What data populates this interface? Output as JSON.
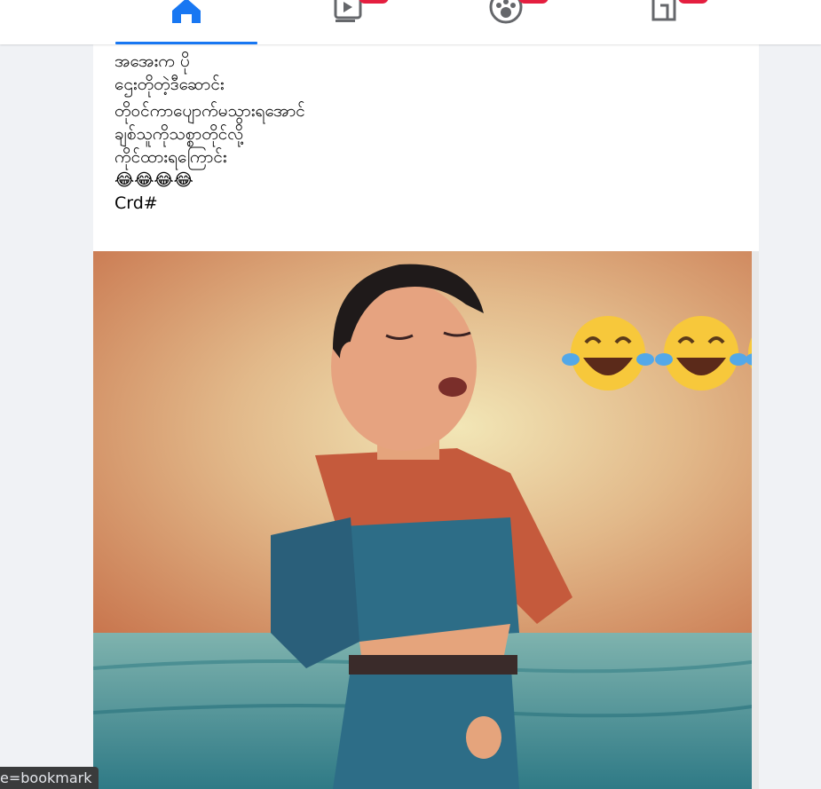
{
  "nav": {
    "tabs": [
      {
        "name": "home",
        "icon": "home-icon",
        "active": true
      },
      {
        "name": "watch",
        "icon": "video-play-icon",
        "active": false
      },
      {
        "name": "groups",
        "icon": "groups-icon",
        "active": false
      },
      {
        "name": "gaming",
        "icon": "gaming-icon",
        "active": false
      }
    ]
  },
  "post": {
    "lines": [
      "အအေးက ပို",
      "ဌေးတိုတဲ့ဒီဆောင်း",
      "တိုဝင်ကာပျောက်မသွားရအောင်",
      "ချစ်သူကိုသစ္စာတိုင်လို့",
      "ကိုင်ထားရကြောင်း",
      "😂😂😂😂",
      "Crd#"
    ],
    "image_emojis": [
      "😂",
      "😂",
      "😂"
    ]
  },
  "status_bar": {
    "text": "e=bookmark"
  },
  "colors": {
    "accent": "#1877f2",
    "badge": "#e41e3f",
    "background": "#f0f2f5"
  }
}
